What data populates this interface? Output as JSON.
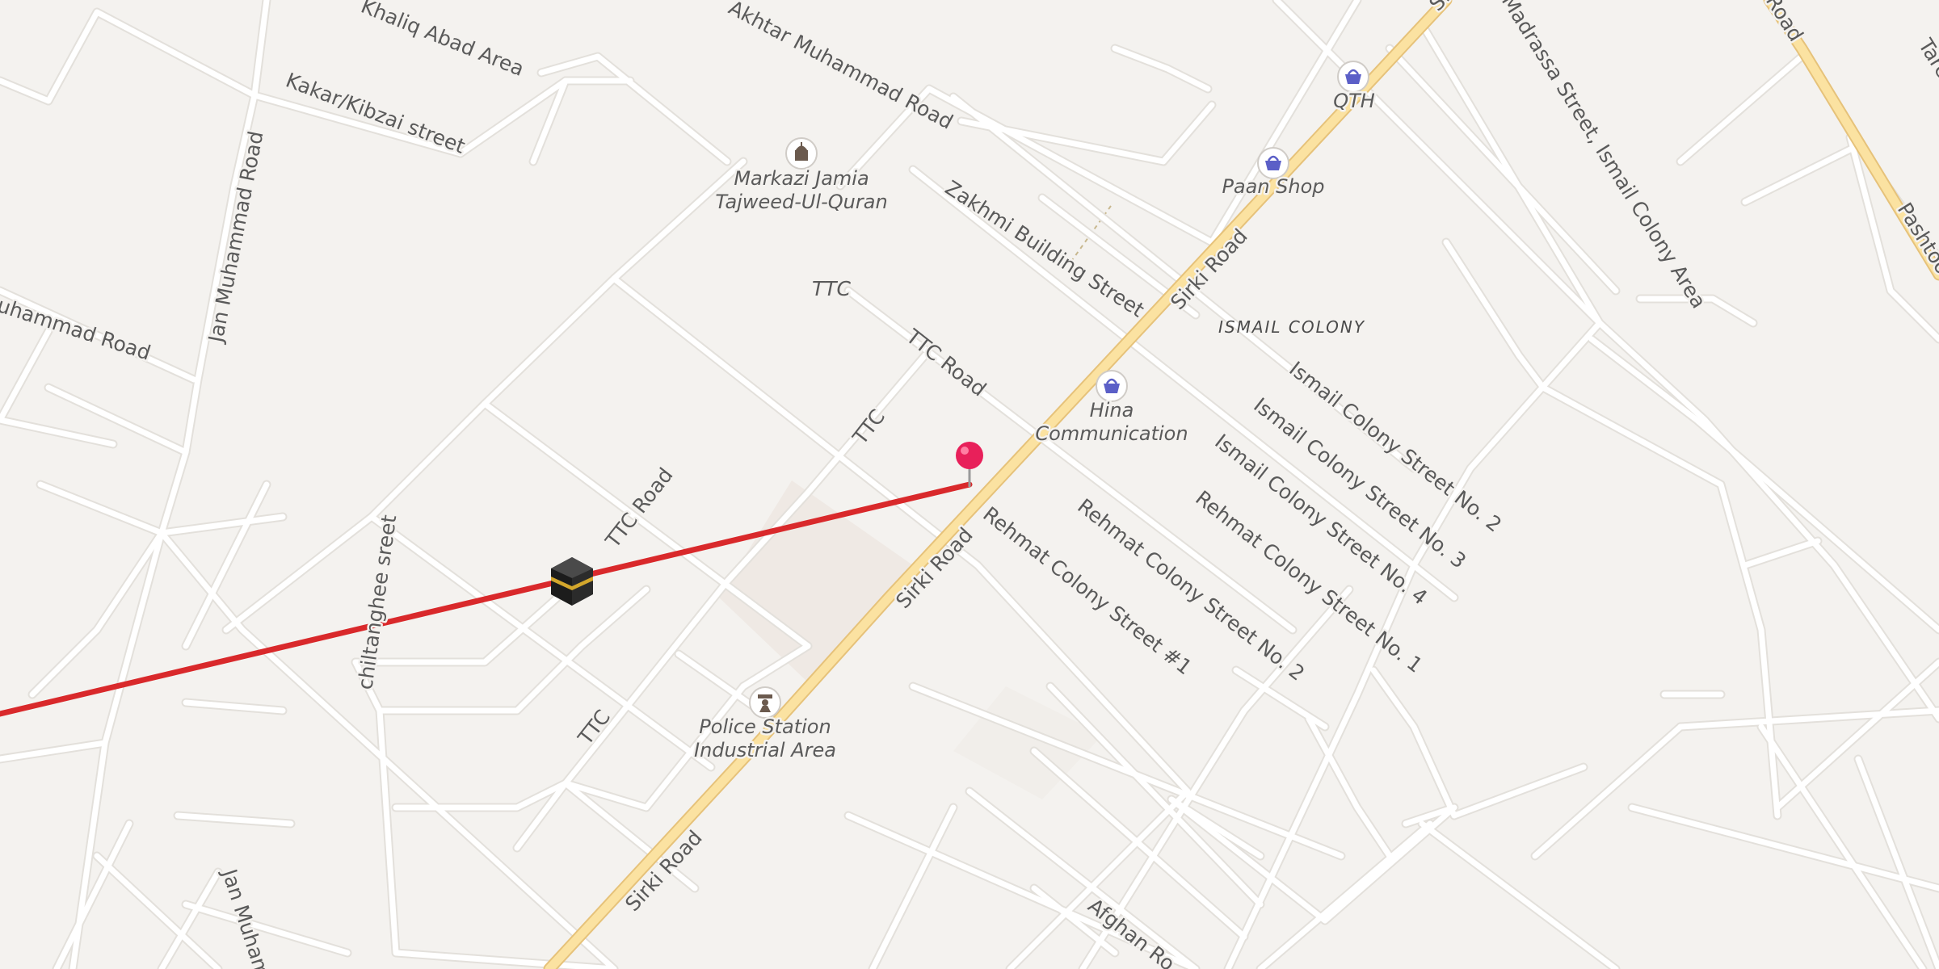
{
  "streets": {
    "khaliq_abad": "Khaliq Abad Area",
    "akhtar_muhammad": "Akhtar Muhammad Road",
    "kakar_kibzai": "Kakar/Kibzai street",
    "jan_muhammad_1": "Jan Muhammad Road",
    "jan_muhammad_2": "Jan Muham",
    "muhammad_road": "uhammad Road",
    "zakhmi_building": "Zakhmi Building Street",
    "sirki_1": "Sirki Road",
    "sirki_2": "Sirki Road",
    "sirki_3": "Sirki Road",
    "sirki_top": "Si",
    "ttc_label": "TTC",
    "ttc_road_1": "TTC Road",
    "ttc_road_2": "TTC Road",
    "ttc_1": "TTC",
    "ttc_2": "TTC",
    "chiltanghee": "chiltanghee sreet",
    "rehmat_1": "Rehmat Colony Street #1",
    "rehmat_2": "Rehmat Colony Street No. 2",
    "rehmat_no1": "Rehmat Colony Street No. 1",
    "ismail_2": "Ismail Colony Street No. 2",
    "ismail_3": "Ismail Colony Street No. 3",
    "ismail_4": "Ismail Colony Street No. 4",
    "madrassa": "Madrassa Street, Ismail Colony Area",
    "pashtoon": "Pashtoo",
    "road_top": "Road",
    "tare": "Tare",
    "afghan": "Afghan Ro"
  },
  "areas": {
    "ismail_colony": "ISMAIL COLONY"
  },
  "pois": {
    "mosque_line1": "Markazi Jamia",
    "mosque_line2": "Tajweed-Ul-Quran",
    "qth": "QTH",
    "paan_shop": "Paan Shop",
    "hina_line1": "Hina",
    "hina_line2": "Communication",
    "police_line1": "Police Station",
    "police_line2": "Industrial Area"
  },
  "colors": {
    "background": "#f4f2ef",
    "minor_road": "#ffffff",
    "major_road": "#fbe2a1",
    "major_road_casing": "#e6c27a",
    "qibla_line": "#d9292b",
    "pin": "#e8205a",
    "shop_icon": "#5b5fc7",
    "amenity_icon": "#6b5a4e"
  },
  "icons": {
    "kaaba": "kaaba-icon",
    "location_pin": "location-pin-icon",
    "shop": "shopping-basket-icon",
    "mosque": "mosque-icon",
    "police": "police-icon"
  }
}
